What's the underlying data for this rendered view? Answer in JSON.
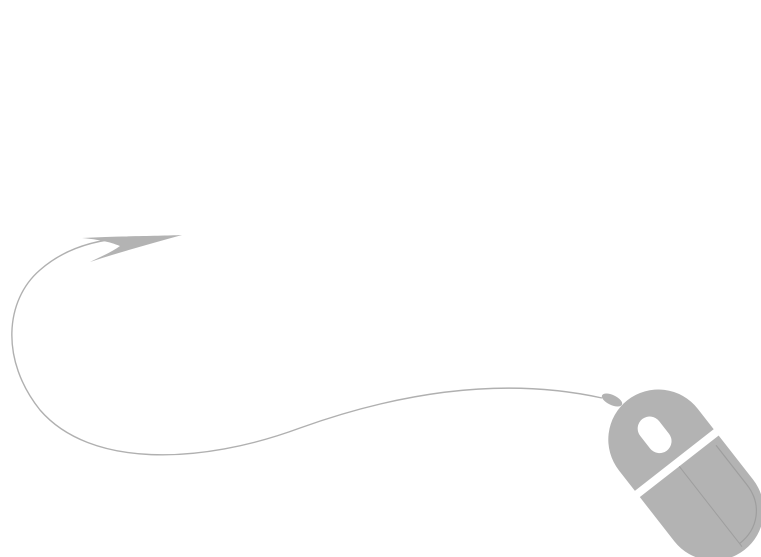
{
  "illustration": {
    "subject": "computer-mouse-with-cable-arrow",
    "colors": {
      "mouse_fill": "#b3b3b3",
      "mouse_outline": "#9e9e9e",
      "cable": "#b0b0b0",
      "arrowhead": "#b3b3b3",
      "divider": "#ffffff",
      "background": "#ffffff"
    }
  }
}
